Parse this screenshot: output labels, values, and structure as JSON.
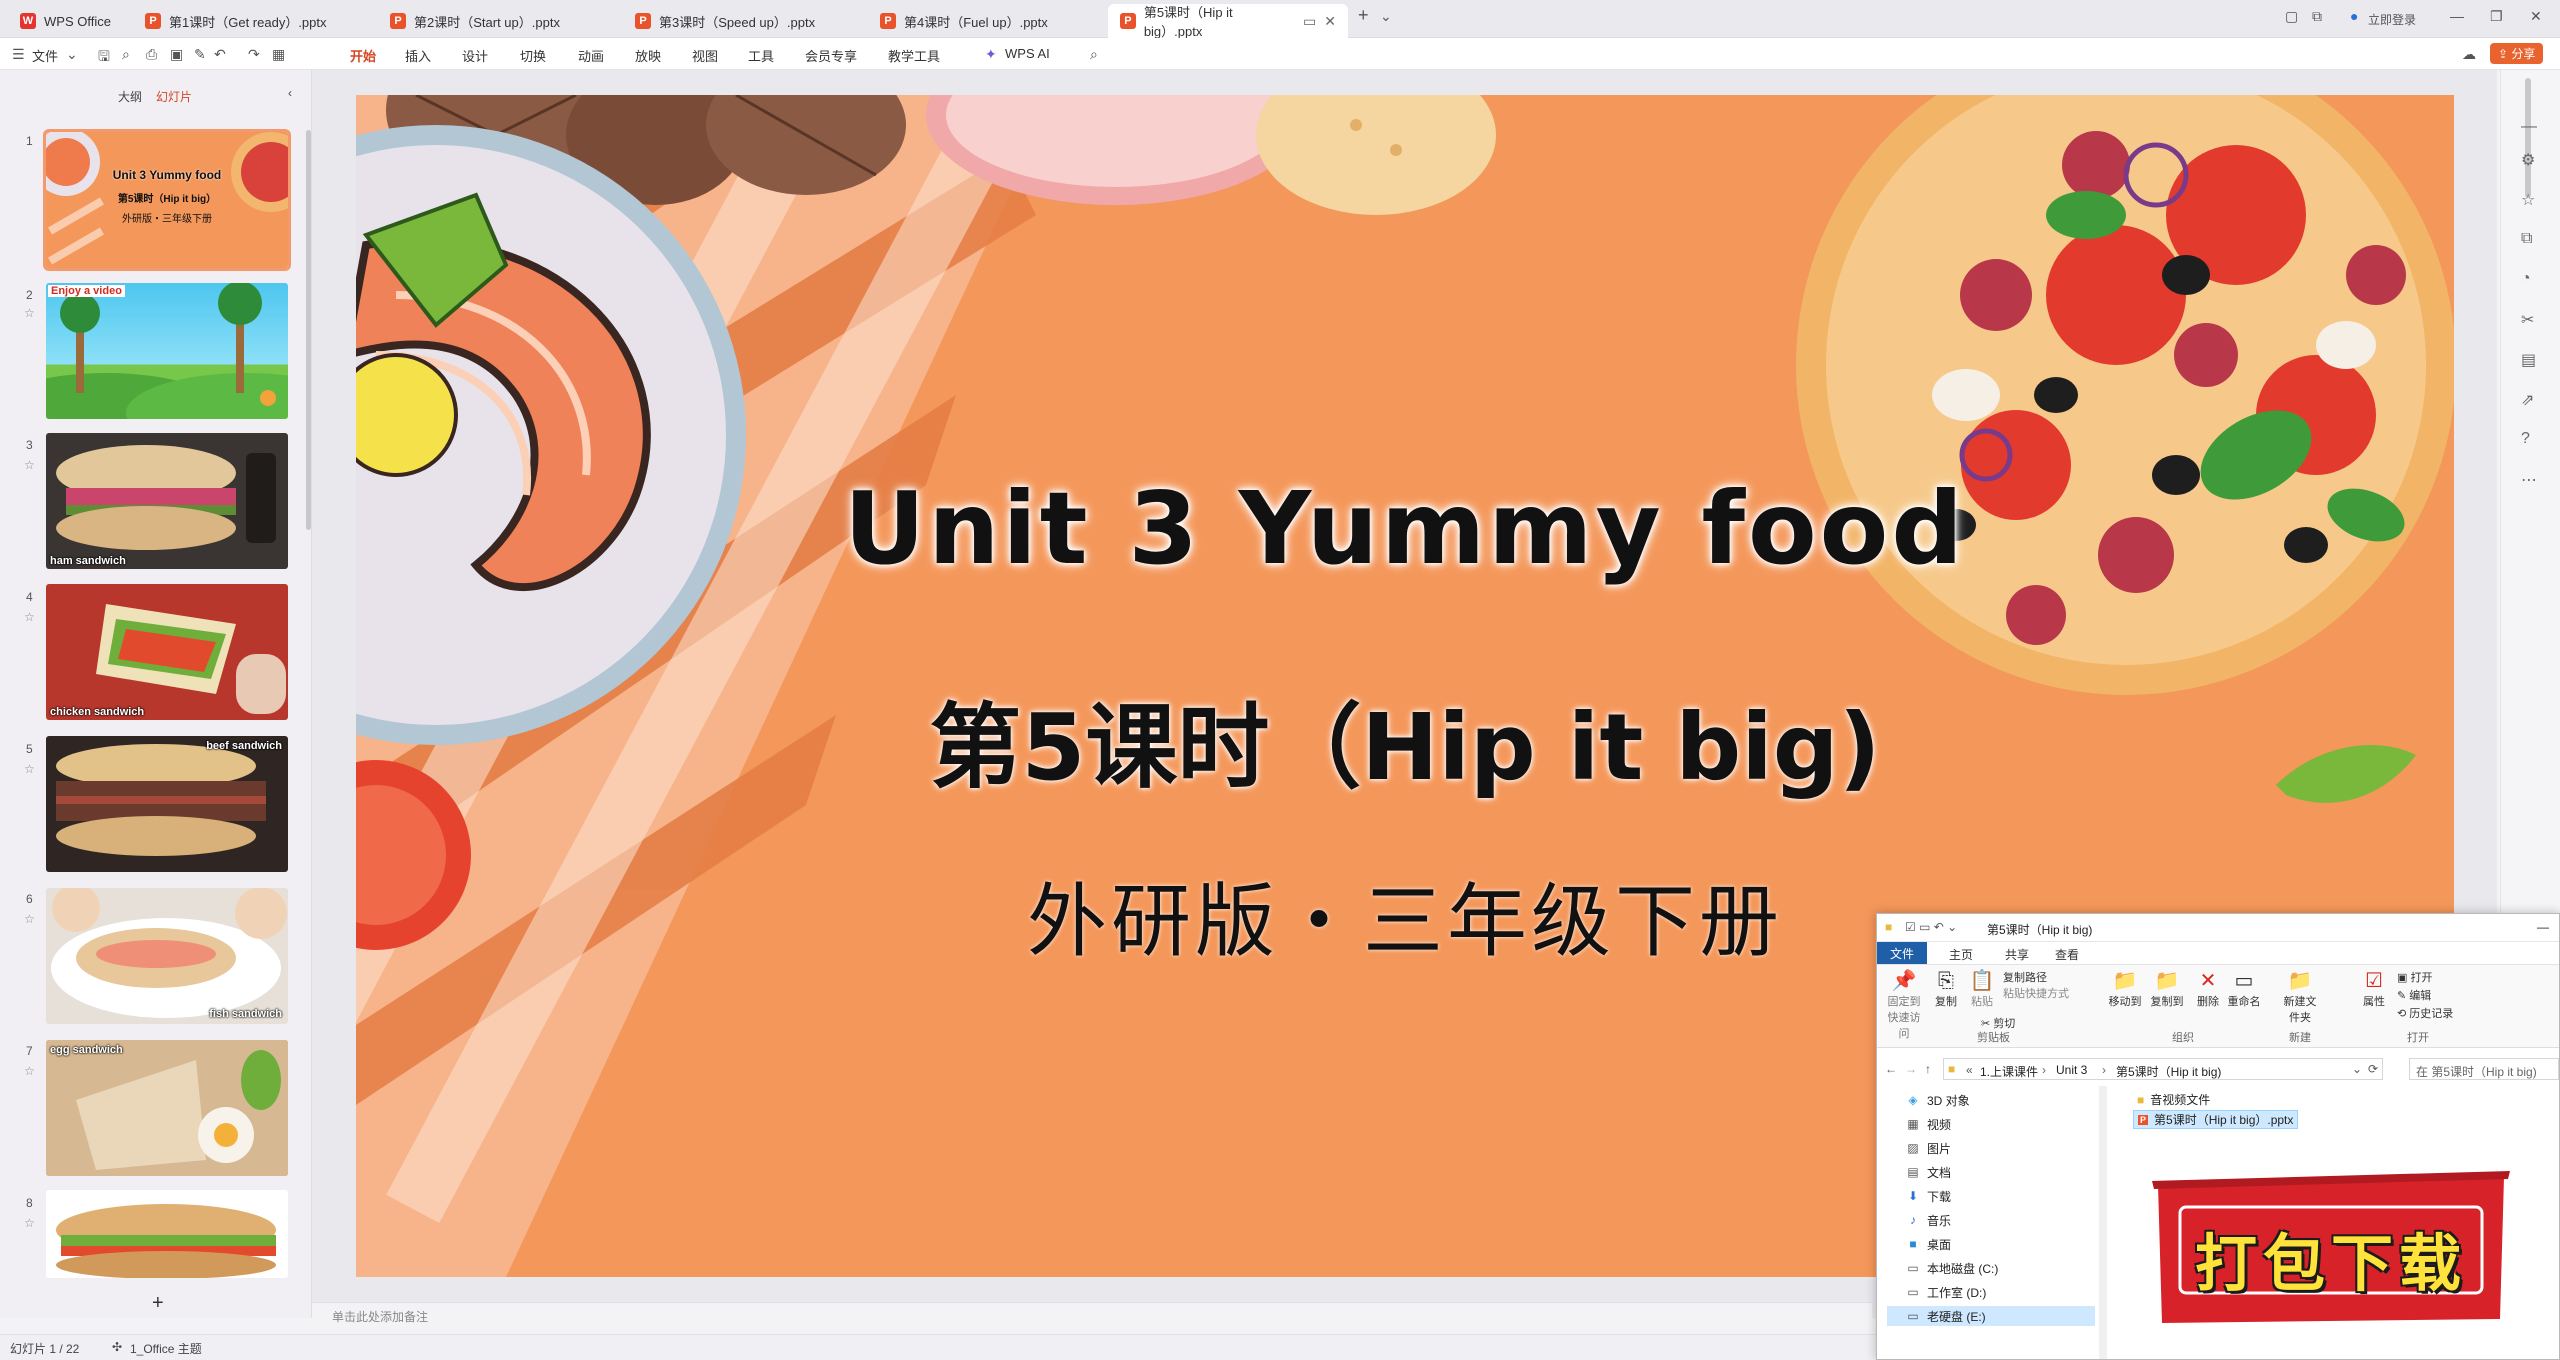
{
  "tabbar": {
    "home": "WPS Office",
    "tabs": [
      {
        "label": "第1课时（Get ready）.pptx"
      },
      {
        "label": "第2课时（Start up）.pptx"
      },
      {
        "label": "第3课时（Speed up）.pptx"
      },
      {
        "label": "第4课时（Fuel up）.pptx"
      },
      {
        "label": "第5课时（Hip it big）.pptx"
      }
    ],
    "login": "立即登录",
    "share": "分享"
  },
  "ribbon": {
    "file_menu": "文件",
    "menus": [
      "开始",
      "插入",
      "设计",
      "切换",
      "动画",
      "放映",
      "视图",
      "工具",
      "会员专享",
      "教学工具"
    ],
    "wps_ai": "WPS AI"
  },
  "left_panel": {
    "tab_outline": "大纲",
    "tab_slides": "幻灯片",
    "slides": [
      {
        "num": "1",
        "lines": [
          "Unit 3   Yummy food",
          "第5课时（Hip it big）",
          "外研版・三年级下册"
        ]
      },
      {
        "num": "2",
        "label": "Enjoy a video"
      },
      {
        "num": "3",
        "label": "ham sandwich"
      },
      {
        "num": "4",
        "label": "chicken sandwich"
      },
      {
        "num": "5",
        "label": "beef sandwich"
      },
      {
        "num": "6",
        "label": "fish sandwich"
      },
      {
        "num": "7",
        "label": "egg sandwich"
      },
      {
        "num": "8",
        "label": ""
      }
    ],
    "add_slide": "+"
  },
  "slide": {
    "title": "Unit 3   Yummy food",
    "lesson": "第5课时（Hip it big)",
    "edition": "外研版・三年级下册"
  },
  "notes_placeholder": "单击此处添加备注",
  "status": {
    "slide_counter": "幻灯片 1 / 22",
    "theme": "1_Office 主题"
  },
  "explorer": {
    "title": "第5课时（Hip it big)",
    "tabs": [
      "文件",
      "主页",
      "共享",
      "查看"
    ],
    "ribbon": {
      "pin": "固定到快速访问",
      "copy": "复制",
      "paste": "粘贴",
      "copy_path": "复制路径",
      "paste_shortcut": "粘贴快捷方式",
      "cut": "剪切",
      "move_to": "移动到",
      "copy_to": "复制到",
      "delete": "删除",
      "rename": "重命名",
      "new_folder": "新建文件夹",
      "properties": "属性",
      "open": "打开",
      "edit": "编辑",
      "history": "历史记录",
      "groups": [
        "剪贴板",
        "组织",
        "新建",
        "打开"
      ]
    },
    "breadcrumb": [
      "1.上课课件",
      "Unit 3",
      "第5课时（Hip it big)"
    ],
    "search_placeholder": "在 第5课时（Hip it big)",
    "tree": [
      "3D 对象",
      "视频",
      "图片",
      "文档",
      "下载",
      "音乐",
      "桌面",
      "本地磁盘 (C:)",
      "工作室 (D:)",
      "老硬盘 (E:)"
    ],
    "files": [
      "音视频文件",
      "第5课时（Hip it big）.pptx"
    ]
  },
  "download_badge": "打包下载",
  "colors": {
    "slide_bg": "#f4975a",
    "accent": "#d24726",
    "badge_red": "#d8222a"
  }
}
